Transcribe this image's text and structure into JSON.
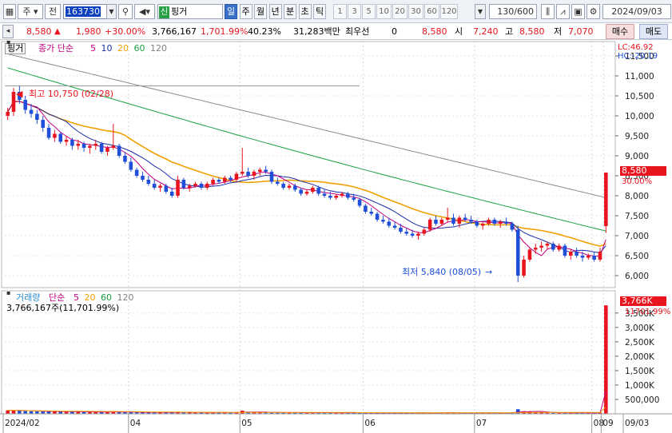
{
  "toolbar": {
    "market": "주",
    "market_type": "전",
    "code": "163730",
    "name_badge": "신",
    "name": "핑거",
    "periods": [
      "일",
      "주",
      "월",
      "년",
      "분",
      "초",
      "틱"
    ],
    "active_period": "일",
    "intervals": [
      "1",
      "3",
      "5",
      "10",
      "20",
      "30",
      "60",
      "120"
    ],
    "count": "130/600",
    "date": "2024/09/03"
  },
  "status": {
    "price": "8,580",
    "change": "1,980",
    "change_pct": "+30.00%",
    "volume": "3,766,167",
    "volume_pct": "1,701.99%",
    "turnover": "40.23%",
    "amount": "31,283백만",
    "preferred_label": "최우선",
    "preferred_value": "0",
    "quote": "8,580",
    "open_label": "시",
    "open": "7,240",
    "high_label": "고",
    "high": "8,580",
    "low_label": "저",
    "low": "7,070",
    "buy": "매수",
    "sell": "매도"
  },
  "price_panel": {
    "name": "핑거",
    "legend_prefix": "종가 단순",
    "legend": [
      {
        "label": "5",
        "color": "#c00080"
      },
      {
        "label": "10",
        "color": "#1a2ea8"
      },
      {
        "label": "20",
        "color": "#f0a000"
      },
      {
        "label": "60",
        "color": "#18a040"
      },
      {
        "label": "120",
        "color": "#808080"
      }
    ],
    "lc": "LC:46.92",
    "hc": "HC:-20.19",
    "high_note": "최고 10,750 (02/28)",
    "low_note": "최저 5,840 (08/05)",
    "last_price": "8,580",
    "last_pct": "30.00%",
    "y_ticks": [
      "11,500",
      "11,000",
      "10,500",
      "10,000",
      "9,500",
      "9,000",
      "8,500",
      "8,000",
      "7,500",
      "7,000",
      "6,500",
      "6,000"
    ]
  },
  "volume_panel": {
    "name": "거래량",
    "legend_prefix": "단순",
    "legend": [
      {
        "label": "5",
        "color": "#c00080"
      },
      {
        "label": "20",
        "color": "#f0a000"
      },
      {
        "label": "60",
        "color": "#18a040"
      },
      {
        "label": "120",
        "color": "#808080"
      }
    ],
    "value_text": "3,766,167주(11,701.99%)",
    "last_vol": "3,766K",
    "last_pct": "11701.99%",
    "y_ticks": [
      "3,500K",
      "3,000K",
      "2,500K",
      "2,000K",
      "1,500K",
      "1,000K",
      "500,000"
    ]
  },
  "x_axis": [
    "2024/02",
    "04",
    "05",
    "06",
    "07",
    "08",
    "09",
    "09/03"
  ],
  "chart_data": {
    "type": "candlestick",
    "title": "핑거",
    "ylim": [
      5700,
      11700
    ],
    "candles": [
      [
        10000,
        10200,
        9900,
        10100
      ],
      [
        10100,
        10700,
        10000,
        10600
      ],
      [
        10600,
        10750,
        10300,
        10400
      ],
      [
        10400,
        10500,
        10050,
        10150
      ],
      [
        10150,
        10300,
        9950,
        10050
      ],
      [
        10050,
        10150,
        9800,
        9900
      ],
      [
        9900,
        10000,
        9600,
        9700
      ],
      [
        9700,
        9800,
        9400,
        9450
      ],
      [
        9450,
        9650,
        9350,
        9550
      ],
      [
        9550,
        9600,
        9300,
        9350
      ],
      [
        9350,
        9500,
        9250,
        9400
      ],
      [
        9400,
        9450,
        9150,
        9250
      ],
      [
        9250,
        9400,
        9150,
        9300
      ],
      [
        9300,
        9350,
        9100,
        9200
      ],
      [
        9200,
        9300,
        9050,
        9250
      ],
      [
        9250,
        9400,
        9150,
        9300
      ],
      [
        9300,
        9350,
        9050,
        9100
      ],
      [
        9100,
        9250,
        9000,
        9200
      ],
      [
        9200,
        9800,
        9150,
        9250
      ],
      [
        9250,
        9300,
        8950,
        9000
      ],
      [
        9000,
        9100,
        8800,
        8850
      ],
      [
        8850,
        8950,
        8600,
        8650
      ],
      [
        8650,
        8700,
        8450,
        8500
      ],
      [
        8500,
        8600,
        8350,
        8400
      ],
      [
        8400,
        8500,
        8250,
        8300
      ],
      [
        8300,
        8400,
        8150,
        8200
      ],
      [
        8200,
        8300,
        8100,
        8250
      ],
      [
        8250,
        8300,
        8050,
        8100
      ],
      [
        8100,
        8200,
        7950,
        8000
      ],
      [
        8000,
        8500,
        7950,
        8400
      ],
      [
        8400,
        8450,
        8150,
        8200
      ],
      [
        8200,
        8300,
        8100,
        8250
      ],
      [
        8250,
        8350,
        8200,
        8300
      ],
      [
        8300,
        8350,
        8150,
        8200
      ],
      [
        8200,
        8350,
        8150,
        8300
      ],
      [
        8300,
        8450,
        8250,
        8400
      ],
      [
        8400,
        8450,
        8300,
        8350
      ],
      [
        8350,
        8500,
        8300,
        8450
      ],
      [
        8450,
        8500,
        8350,
        8400
      ],
      [
        8400,
        8600,
        8350,
        8550
      ],
      [
        8550,
        9200,
        8500,
        8600
      ],
      [
        8600,
        8700,
        8450,
        8500
      ],
      [
        8500,
        8650,
        8400,
        8600
      ],
      [
        8600,
        8700,
        8500,
        8650
      ],
      [
        8650,
        8750,
        8550,
        8600
      ],
      [
        8600,
        8650,
        8300,
        8350
      ],
      [
        8350,
        8450,
        8250,
        8300
      ],
      [
        8300,
        8350,
        8150,
        8200
      ],
      [
        8200,
        8300,
        8150,
        8250
      ],
      [
        8250,
        8300,
        8100,
        8150
      ],
      [
        8150,
        8200,
        8000,
        8050
      ],
      [
        8050,
        8150,
        8000,
        8100
      ],
      [
        8100,
        8250,
        8050,
        8200
      ],
      [
        8200,
        8250,
        8000,
        8050
      ],
      [
        8050,
        8150,
        7950,
        8000
      ],
      [
        8000,
        8100,
        7900,
        7950
      ],
      [
        7950,
        8050,
        7900,
        8000
      ],
      [
        8000,
        8100,
        7950,
        8050
      ],
      [
        8050,
        8100,
        7900,
        7950
      ],
      [
        7950,
        8050,
        7850,
        7900
      ],
      [
        7900,
        7950,
        7700,
        7750
      ],
      [
        7750,
        7800,
        7550,
        7600
      ],
      [
        7600,
        7700,
        7500,
        7550
      ],
      [
        7550,
        7600,
        7350,
        7400
      ],
      [
        7400,
        7500,
        7300,
        7350
      ],
      [
        7350,
        7450,
        7200,
        7250
      ],
      [
        7250,
        7350,
        7150,
        7200
      ],
      [
        7200,
        7300,
        7050,
        7100
      ],
      [
        7100,
        7200,
        7000,
        7050
      ],
      [
        7050,
        7150,
        6950,
        7000
      ],
      [
        7000,
        7100,
        6900,
        7050
      ],
      [
        7050,
        7200,
        7000,
        7150
      ],
      [
        7150,
        7450,
        7100,
        7400
      ],
      [
        7400,
        7500,
        7250,
        7300
      ],
      [
        7300,
        7450,
        7250,
        7400
      ],
      [
        7400,
        7700,
        7350,
        7450
      ],
      [
        7450,
        7550,
        7250,
        7300
      ],
      [
        7300,
        7500,
        7200,
        7450
      ],
      [
        7450,
        7550,
        7350,
        7400
      ],
      [
        7400,
        7500,
        7300,
        7350
      ],
      [
        7350,
        7400,
        7200,
        7250
      ],
      [
        7250,
        7350,
        7150,
        7300
      ],
      [
        7300,
        7450,
        7250,
        7400
      ],
      [
        7400,
        7450,
        7250,
        7300
      ],
      [
        7300,
        7400,
        7200,
        7350
      ],
      [
        7350,
        7450,
        7250,
        7300
      ],
      [
        7300,
        7350,
        7100,
        7150
      ],
      [
        7150,
        7250,
        5840,
        6000
      ],
      [
        6000,
        6500,
        5950,
        6400
      ],
      [
        6400,
        6700,
        6350,
        6650
      ],
      [
        6650,
        6800,
        6550,
        6700
      ],
      [
        6700,
        6850,
        6600,
        6750
      ],
      [
        6750,
        6850,
        6650,
        6800
      ],
      [
        6800,
        6850,
        6600,
        6650
      ],
      [
        6650,
        6800,
        6600,
        6750
      ],
      [
        6750,
        6800,
        6450,
        6500
      ],
      [
        6500,
        6650,
        6400,
        6600
      ],
      [
        6600,
        6700,
        6450,
        6500
      ],
      [
        6500,
        6600,
        6350,
        6450
      ],
      [
        6450,
        6550,
        6400,
        6500
      ],
      [
        6500,
        6600,
        6350,
        6400
      ],
      [
        6400,
        6700,
        6350,
        6600
      ],
      [
        7240,
        8580,
        7070,
        8580
      ]
    ],
    "volume": [
      120,
      130,
      110,
      95,
      90,
      85,
      80,
      82,
      78,
      75,
      70,
      72,
      68,
      65,
      66,
      64,
      62,
      60,
      90,
      58,
      55,
      54,
      52,
      50,
      50,
      48,
      49,
      47,
      46,
      70,
      45,
      44,
      46,
      45,
      44,
      46,
      45,
      47,
      46,
      48,
      110,
      52,
      50,
      48,
      46,
      45,
      44,
      43,
      44,
      42,
      41,
      42,
      43,
      41,
      40,
      39,
      40,
      41,
      39,
      38,
      37,
      36,
      37,
      35,
      34,
      33,
      34,
      33,
      32,
      31,
      33,
      34,
      40,
      36,
      35,
      45,
      34,
      35,
      33,
      32,
      31,
      32,
      34,
      33,
      32,
      31,
      30,
      160,
      90,
      70,
      55,
      45,
      40,
      36,
      35,
      36,
      34,
      33,
      32,
      31,
      30,
      42,
      3766
    ]
  }
}
